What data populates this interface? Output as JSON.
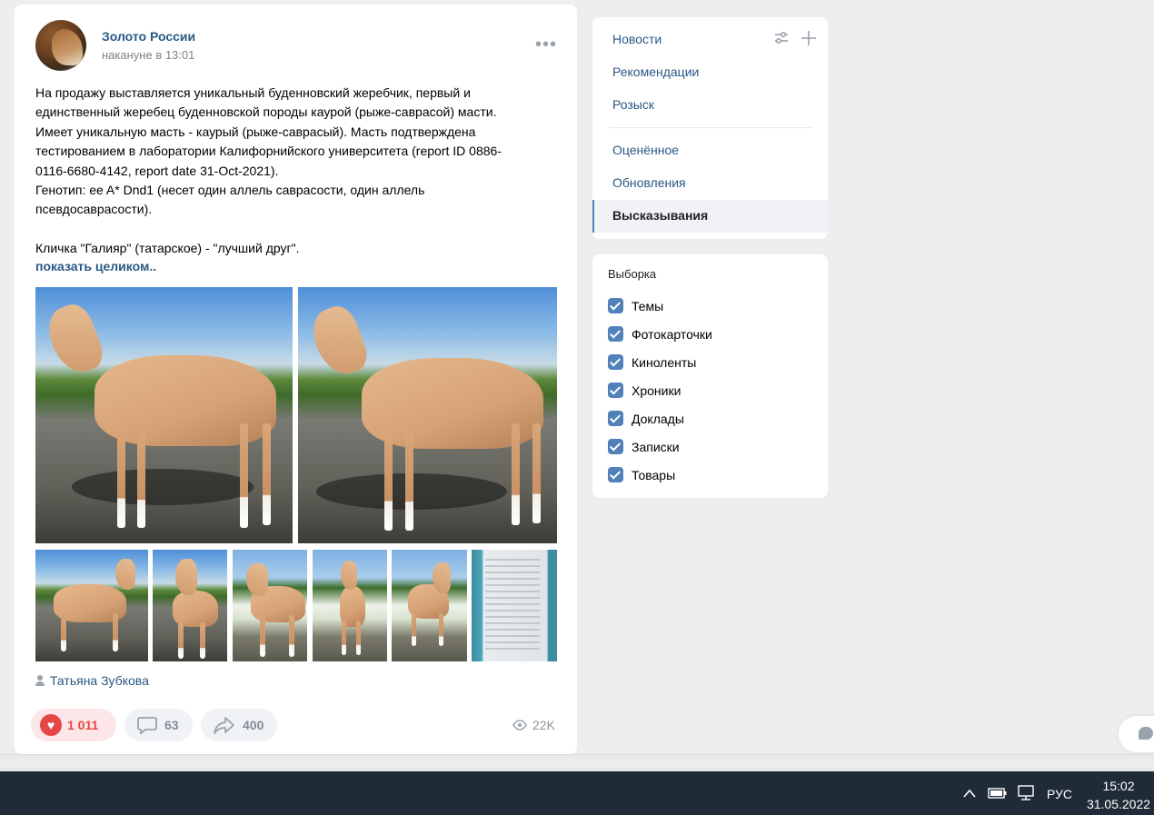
{
  "post": {
    "author": "Золото России",
    "time": "накануне в 13:01",
    "menu_dots": "•••",
    "text_lines": [
      "На продажу выставляется уникальный буденновский жеребчик, первый и",
      "единственный жеребец буденновской породы каурой (рыже-саврасой) масти.",
      "Имеет уникальную масть - каурый (рыже-саврасый). Масть подтверждена",
      "тестированием в лаборатории Калифорнийского университета (report ID 0886-",
      "0116-6680-4142, report date 31-Oct-2021).",
      "Генотип: ee A* Dnd1 (несет один аллель саврасости, один аллель",
      "псевдосаврасости).",
      "",
      "Кличка \"Галияр\" (татарское) - \"лучший друг\"."
    ],
    "show_more": "показать целиком..",
    "signer": "Татьяна Зубкова",
    "likes": "1 011",
    "comments": "63",
    "shares": "400",
    "views": "22K"
  },
  "menu": {
    "items": [
      "Новости",
      "Рекомендации",
      "Розыск",
      "Оценённое",
      "Обновления"
    ],
    "active": "Высказывания"
  },
  "filter": {
    "title": "Выборка",
    "options": [
      "Темы",
      "Фотокарточки",
      "Киноленты",
      "Хроники",
      "Доклады",
      "Записки",
      "Товары"
    ]
  },
  "taskbar": {
    "lang": "РУС",
    "time": "15:02",
    "date": "31.05.2022"
  },
  "colors": {
    "link": "#2a5885",
    "accent": "#5181b8",
    "like": "#e64646",
    "taskbar": "#202b38"
  }
}
